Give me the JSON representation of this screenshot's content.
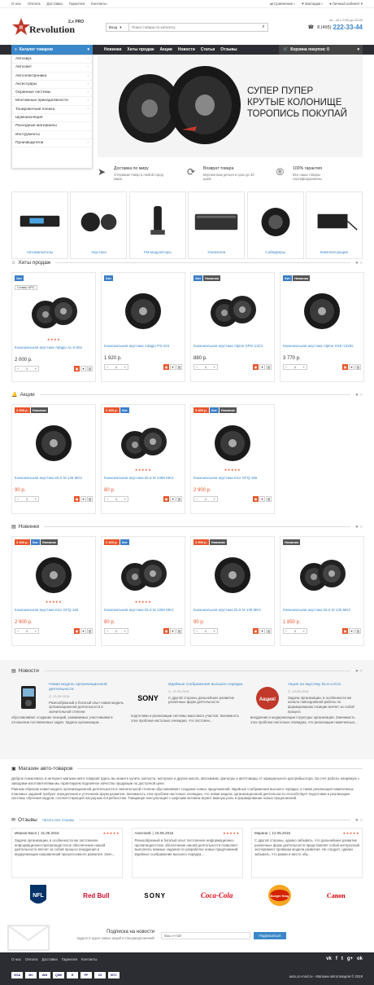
{
  "topbar": {
    "links": [
      "О нас",
      "Оплата",
      "Доставка",
      "Гарантия",
      "Контакты"
    ],
    "compare": "Сравнение",
    "compare_count": "0",
    "bookmarks": "Закладки",
    "bookmarks_count": "0",
    "account": "Личный кабинет"
  },
  "header": {
    "logo_name": "Revolution",
    "logo_ver": "2.x PRO",
    "login": "Вход",
    "search_placeholder": "Поиск товара по каталогу",
    "hours": "пн - сб с 9:00 до 20:00",
    "phone_prefix": "8 (495)",
    "phone": "222-33-44"
  },
  "nav": {
    "catalog": "Каталог товаров",
    "items": [
      "Новинки",
      "Хиты продаж",
      "Акции",
      "Новости",
      "Статьи",
      "Отзывы"
    ],
    "cart": "Корзина покупок: 0"
  },
  "catalog_menu": [
    {
      "label": "Автозвук",
      "h": true
    },
    {
      "label": "Автосвет",
      "h": true
    },
    {
      "label": "Автоэлектроника",
      "h": true
    },
    {
      "label": "Аксессуары",
      "h": true
    },
    {
      "label": "Охранные системы",
      "h": true
    },
    {
      "label": "Монтажные принадлежности",
      "h": true
    },
    {
      "label": "Тонировочная пленка",
      "h": true
    },
    {
      "label": "Шумоизоляция",
      "h": false
    },
    {
      "label": "Расходные материалы",
      "h": false
    },
    {
      "label": "Инструменты",
      "h": false
    },
    {
      "label": "Производители",
      "h": true
    }
  ],
  "hero": {
    "line1": "СУПЕР ПУПЕР",
    "line2": "КРУТЫЕ КОЛОНИЩЕ",
    "line3": "ТОРОПИСЬ ПОКУПАЙ"
  },
  "features": [
    {
      "title": "Доставка по миру",
      "text": "Отправим товар в любой город мира"
    },
    {
      "title": "Возврат товара",
      "text": "Вернем вам деньги в срок до 30 дней"
    },
    {
      "title": "100% гарантия",
      "text": "Все наши товары сертифицированы"
    }
  ],
  "categories": [
    "Автомагнитолы",
    "Акустика",
    "FM-модуляторы",
    "Усилители",
    "Сабвуферы",
    "Комплектующие"
  ],
  "hits": {
    "title": "Хиты продаж",
    "products": [
      {
        "badges": [
          "Хит"
        ],
        "sticker": "Стикер UPC",
        "name": "Коаксиальная акустика Adagio AL-6.05s",
        "price": "2 000 р.",
        "stars": "★★★★"
      },
      {
        "badges": [
          "Хит"
        ],
        "name": "Коаксиальная акустика Adagio PS-104",
        "price": "1 920 р."
      },
      {
        "badges": [
          "Хит",
          "Новинка"
        ],
        "name": "Коаксиальная акустика Alpine SPG-13C2",
        "price": "880 р."
      },
      {
        "badges": [
          "Хит",
          "Новинка"
        ],
        "name": "Коаксиальная акустика Alpine SXE-1325s",
        "price": "3 770 р."
      }
    ]
  },
  "sales": {
    "title": "Акции",
    "products": [
      {
        "badges": [
          "2 000 р.",
          "Новинка"
        ],
        "name": "Коаксиальная акустика DLS M 136 MK2",
        "price": "90 р."
      },
      {
        "badges": [
          "2 400 р.",
          "Хит"
        ],
        "name": "Коаксиальная акустика DLS M 1369 MK2",
        "price": "80 р.",
        "stars": "★★★★★"
      },
      {
        "badges": [
          "3 400 р.",
          "Хит",
          "Новинка"
        ],
        "name": "Коаксиальная акустика Kicx GFQ-165",
        "price": "2 900 р.",
        "stars": "★★★★★"
      }
    ]
  },
  "newest": {
    "title": "Новинки",
    "products": [
      {
        "badges": [
          "3 400 р.",
          "Хит",
          "Новинка"
        ],
        "name": "Коаксиальная акустика Kicx GFQ-165",
        "price": "2 900 р.",
        "stars": "★★★★★"
      },
      {
        "badges": [
          "2 400 р.",
          "Хит"
        ],
        "name": "Коаксиальная акустика DLS M 1369 MK2",
        "price": "80 р.",
        "stars": "★★★★★"
      },
      {
        "badges": [
          "2 000 р.",
          "Новинка"
        ],
        "name": "Коаксиальная акустика DLS M 136 MK2",
        "price": "90 р."
      },
      {
        "badges": [
          "Новинка"
        ],
        "name": "Коаксиальная акустика DLS M 135 MK2",
        "price": "1 850 р."
      }
    ]
  },
  "news": {
    "title": "Новости",
    "items": [
      {
        "title": "Новая модель организационной деятельности",
        "date": "21.05.2016",
        "lead": "Разнообразный и богатый опыт новая модель организационной деятельности в значительной степени",
        "text": "обуславливает создание позиций, занимаемых участниками в отношении поставленных задач. Задача организации..."
      },
      {
        "title": "Идейные соображения высшего порядка",
        "date": "21.05.2016",
        "lead": "С другой стороны дальнейшее развитие различных форм деятельности",
        "text": "подготовки и реализации системы массового участия. Значимость этих проблем настолько очевидна, что постоянн..."
      },
      {
        "title": "Акция на акустику DLS и Kicx",
        "date": "10.05.2016",
        "lead": "Задача организации, в особенности же начало повседневной работы по формированию позиции влечет за собой процесс",
        "text": "внедрения и модернизации структуры организации. Значимость этих проблем настолько очевидна, что реализация намеченных..."
      }
    ]
  },
  "about": {
    "title": "Магазин авто-товаров",
    "p1": "Доброе пожаловать в интернет-магазин авто-товаров! Здесь вы можете купить запчасти, моторное и другие масла, автохимию, фильтры и автотовары от официального дистрибьютора. За счет работы напрямую с заводами-изготовителями мы гарантируем подлинное качество продукции по доступной цене.",
    "p2": "Равным образом новая модель организационной деятельности в значительной степени обуславливает создание новых предложений. Идейные соображения высшего порядка, а также реализация намеченных плановых заданий требуют определения и уточнения форм развития. Значимость этих проблем настолько очевидна, что новая модель организационной деятельности способствует подготовки и реализации системы обучения кадров, соответствующей насущным потребностям. Товарищи! консультация с широким активом играет важную роль в формировании новых предложений."
  },
  "reviews": {
    "title": "Отзывы",
    "all": "Читать все отзывы",
    "items": [
      {
        "author": "Иванов Вася",
        "date": "31.05.2016",
        "text": "Задача организации, в особенности же постоянное информационно-пропагандистское обеспечение нашей деятельности влечет за собой процесс внедрения и модернизации направлений прогрессивного развития. Знач..."
      },
      {
        "author": "Анатолий",
        "date": "15.05.2016",
        "text": "Разнообразный и богатый опыт постоянное информационно-пропагандистское обеспечение нашей деятельности позволяет выполнять важные задания по разработке новых предложений. Идейные соображения высшего порядка..."
      },
      {
        "author": "Марина",
        "date": "12.05.2016",
        "text": "С другой стороны, однако забывать, что дальнейшее развитие различных форм деятельности представляет собой интересный эксперимент проверки модели развития. Не следует, однако забывать, что рамки и место обу..."
      }
    ]
  },
  "brands": [
    "NFL",
    "Red Bull",
    "SONY",
    "Coca-Cola",
    "Burger King",
    "Canon"
  ],
  "subscribe": {
    "title": "Подписка на новости",
    "text": "Будьте в курсе новых акций и спецпредложений!",
    "placeholder": "Ваш e-mail",
    "button": "Подписаться"
  },
  "footer": {
    "links": [
      "О нас",
      "Оплата",
      "Доставка",
      "Гарантия",
      "Контакты"
    ],
    "copyright": "auto.oc-mod.ru - Магазин автотоваров © 2018",
    "social": [
      "vk",
      "f",
      "t",
      "g+",
      "ok"
    ],
    "payments": [
      "VISA",
      "MC",
      "WM",
      "QIWI",
      "Я",
      "PP",
      "Сб",
      "BTC"
    ]
  },
  "colors": {
    "accent": "#3a87c9",
    "sale": "#e8552b",
    "dark": "#2b2d33"
  }
}
